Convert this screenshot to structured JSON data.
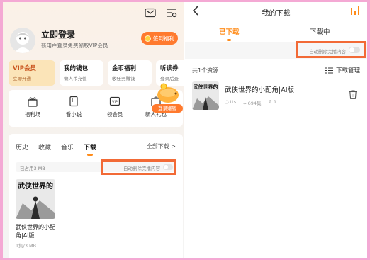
{
  "left": {
    "header_icons": [
      "mail-icon",
      "settings-list-icon"
    ],
    "login": {
      "title": "立即登录",
      "subtitle": "新用户登录免费领取VIP会员",
      "signin_button": "签到福利"
    },
    "cards": [
      {
        "title": "VIP会员",
        "subtitle": "立即开通"
      },
      {
        "title": "我的钱包",
        "subtitle": "懒人币充值"
      },
      {
        "title": "金币福利",
        "subtitle": "收任务赚钱"
      },
      {
        "title": "听读券",
        "subtitle": "登录后查"
      }
    ],
    "grid": [
      {
        "label": "福利场",
        "icon": "gift-icon"
      },
      {
        "label": "看小说",
        "icon": "book-icon"
      },
      {
        "label": "领会员",
        "icon": "vip-ticket-icon"
      },
      {
        "label": "新人礼包",
        "icon": "gift-bag-icon"
      }
    ],
    "piggy_tag": "登录赚钱",
    "history": {
      "tabs": [
        "历史",
        "收藏",
        "音乐",
        "下载"
      ],
      "active_tab": "下载",
      "all_downloads": "全部下载 >",
      "used_storage": "已占用3 MB",
      "auto_delete_label": "自动删除完播内容",
      "book": {
        "title": "武侠世界的小配角|AI版",
        "meta": "1集/3 MB",
        "cover_text": "武侠世界的"
      }
    }
  },
  "right": {
    "title": "我的下载",
    "tabs": [
      "已下载",
      "下载中"
    ],
    "active_tab": "已下载",
    "auto_delete_label": "自动删除完播内容",
    "resource_count": "共1个资源",
    "manage_label": "下载管理",
    "item": {
      "title": "武侠世界的小配角|AI版",
      "author": "tts",
      "plays": "694集",
      "count": "1",
      "cover_text": "武侠世界的"
    }
  },
  "colors": {
    "accent": "#ff8c1a",
    "highlight": "#f26a36",
    "frame": "#f4a9d4"
  }
}
